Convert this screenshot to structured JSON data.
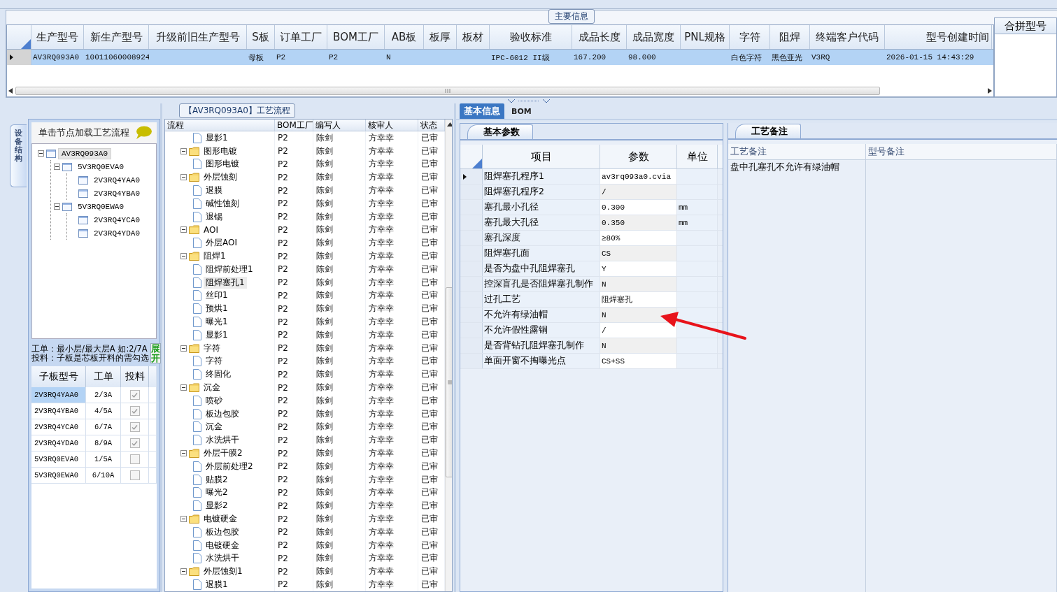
{
  "main_info": {
    "title": "主要信息",
    "columns": [
      "生产型号",
      "新生产型号",
      "升级前旧生产型号",
      "S板",
      "订单工厂",
      "BOM工厂",
      "AB板",
      "板厚",
      "板材",
      "验收标准",
      "成品长度",
      "成品宽度",
      "PNL规格",
      "字符",
      "阻焊",
      "终端客户代码",
      "型号创建时间"
    ],
    "rows": [
      {
        "selected": true,
        "cells": [
          "AV3RQ093A0",
          "10011060008924",
          "",
          "母板",
          "P2",
          "P2",
          "N",
          "",
          "",
          "IPC-6012 II级",
          "167.200",
          "98.000",
          "",
          "白色字符",
          "黑色亚光",
          "V3RQ",
          "2026-01-15 14:43:29"
        ]
      }
    ],
    "side_column": "合拼型号"
  },
  "equipment_panel": {
    "tab": "设备结构",
    "hint": "单击节点加载工艺流程",
    "tree": [
      {
        "label": "AV3RQ093A0",
        "selected": true,
        "expanded": true,
        "children": [
          {
            "label": "5V3RQ0EVA0",
            "selected": false,
            "expanded": true,
            "children": [
              {
                "label": "2V3RQ4YAA0",
                "selected": false
              },
              {
                "label": "2V3RQ4YBA0",
                "selected": false
              }
            ]
          },
          {
            "label": "5V3RQ0EWA0",
            "selected": false,
            "expanded": true,
            "children": [
              {
                "label": "2V3RQ4YCA0",
                "selected": false
              },
              {
                "label": "2V3RQ4YDA0",
                "selected": false
              }
            ]
          }
        ]
      }
    ],
    "note_lines": [
      "工单：最小层/最大层A 如:2/7A",
      "投料：子板是芯板开料的需勾选"
    ],
    "expand_button": "展开",
    "sub_boards": {
      "columns": [
        "子板型号",
        "工单",
        "投料"
      ],
      "rows": [
        {
          "model": "2V3RQ4YAA0",
          "order": "2/3A",
          "feed": true,
          "selected": true
        },
        {
          "model": "2V3RQ4YBA0",
          "order": "4/5A",
          "feed": true,
          "selected": false
        },
        {
          "model": "2V3RQ4YCA0",
          "order": "6/7A",
          "feed": true,
          "selected": false
        },
        {
          "model": "2V3RQ4YDA0",
          "order": "8/9A",
          "feed": true,
          "selected": false
        },
        {
          "model": "5V3RQ0EVA0",
          "order": "1/5A",
          "feed": false,
          "selected": false
        },
        {
          "model": "5V3RQ0EWA0",
          "order": "6/10A",
          "feed": false,
          "selected": false
        }
      ]
    }
  },
  "process_flow": {
    "title": "【AV3RQ093A0】工艺流程",
    "columns": [
      "流程",
      "BOM工厂",
      "编写人",
      "核审人",
      "状态"
    ],
    "rows": [
      {
        "kind": "step",
        "name": "显影1",
        "bom": "P2",
        "writer": "陈剑",
        "reviewer": "方幸幸",
        "status": "已审",
        "selected": false
      },
      {
        "kind": "group",
        "name": "图形电镀",
        "bom": "P2",
        "writer": "陈剑",
        "reviewer": "方幸幸",
        "status": "已审",
        "selected": false,
        "expanded": true,
        "children": [
          {
            "kind": "step",
            "name": "图形电镀",
            "bom": "P2",
            "writer": "陈剑",
            "reviewer": "方幸幸",
            "status": "已审",
            "selected": false
          }
        ]
      },
      {
        "kind": "group",
        "name": "外层蚀刻",
        "bom": "P2",
        "writer": "陈剑",
        "reviewer": "方幸幸",
        "status": "已审",
        "selected": false,
        "expanded": true,
        "children": [
          {
            "kind": "step",
            "name": "退膜",
            "bom": "P2",
            "writer": "陈剑",
            "reviewer": "方幸幸",
            "status": "已审",
            "selected": false
          },
          {
            "kind": "step",
            "name": "碱性蚀刻",
            "bom": "P2",
            "writer": "陈剑",
            "reviewer": "方幸幸",
            "status": "已审",
            "selected": false
          },
          {
            "kind": "step",
            "name": "退锡",
            "bom": "P2",
            "writer": "陈剑",
            "reviewer": "方幸幸",
            "status": "已审",
            "selected": false
          }
        ]
      },
      {
        "kind": "group",
        "name": "AOI",
        "bom": "P2",
        "writer": "陈剑",
        "reviewer": "方幸幸",
        "status": "已审",
        "selected": false,
        "expanded": true,
        "children": [
          {
            "kind": "step",
            "name": "外层AOI",
            "bom": "P2",
            "writer": "陈剑",
            "reviewer": "方幸幸",
            "status": "已审",
            "selected": false
          }
        ]
      },
      {
        "kind": "group",
        "name": "阻焊1",
        "bom": "P2",
        "writer": "陈剑",
        "reviewer": "方幸幸",
        "status": "已审",
        "selected": false,
        "expanded": true,
        "children": [
          {
            "kind": "step",
            "name": "阻焊前处理1",
            "bom": "P2",
            "writer": "陈剑",
            "reviewer": "方幸幸",
            "status": "已审",
            "selected": false
          },
          {
            "kind": "step",
            "name": "阻焊塞孔1",
            "bom": "P2",
            "writer": "陈剑",
            "reviewer": "方幸幸",
            "status": "已审",
            "selected": true
          },
          {
            "kind": "step",
            "name": "丝印1",
            "bom": "P2",
            "writer": "陈剑",
            "reviewer": "方幸幸",
            "status": "已审",
            "selected": false
          },
          {
            "kind": "step",
            "name": "预烘1",
            "bom": "P2",
            "writer": "陈剑",
            "reviewer": "方幸幸",
            "status": "已审",
            "selected": false
          },
          {
            "kind": "step",
            "name": "曝光1",
            "bom": "P2",
            "writer": "陈剑",
            "reviewer": "方幸幸",
            "status": "已审",
            "selected": false
          },
          {
            "kind": "step",
            "name": "显影1",
            "bom": "P2",
            "writer": "陈剑",
            "reviewer": "方幸幸",
            "status": "已审",
            "selected": false
          }
        ]
      },
      {
        "kind": "group",
        "name": "字符",
        "bom": "P2",
        "writer": "陈剑",
        "reviewer": "方幸幸",
        "status": "已审",
        "selected": false,
        "expanded": true,
        "children": [
          {
            "kind": "step",
            "name": "字符",
            "bom": "P2",
            "writer": "陈剑",
            "reviewer": "方幸幸",
            "status": "已审",
            "selected": false
          },
          {
            "kind": "step",
            "name": "终固化",
            "bom": "P2",
            "writer": "陈剑",
            "reviewer": "方幸幸",
            "status": "已审",
            "selected": false
          }
        ]
      },
      {
        "kind": "group",
        "name": "沉金",
        "bom": "P2",
        "writer": "陈剑",
        "reviewer": "方幸幸",
        "status": "已审",
        "selected": false,
        "expanded": true,
        "children": [
          {
            "kind": "step",
            "name": "喷砂",
            "bom": "P2",
            "writer": "陈剑",
            "reviewer": "方幸幸",
            "status": "已审",
            "selected": false
          },
          {
            "kind": "step",
            "name": "板边包胶",
            "bom": "P2",
            "writer": "陈剑",
            "reviewer": "方幸幸",
            "status": "已审",
            "selected": false
          },
          {
            "kind": "step",
            "name": "沉金",
            "bom": "P2",
            "writer": "陈剑",
            "reviewer": "方幸幸",
            "status": "已审",
            "selected": false
          },
          {
            "kind": "step",
            "name": "水洗烘干",
            "bom": "P2",
            "writer": "陈剑",
            "reviewer": "方幸幸",
            "status": "已审",
            "selected": false
          }
        ]
      },
      {
        "kind": "group",
        "name": "外层干膜2",
        "bom": "P2",
        "writer": "陈剑",
        "reviewer": "方幸幸",
        "status": "已审",
        "selected": false,
        "expanded": true,
        "children": [
          {
            "kind": "step",
            "name": "外层前处理2",
            "bom": "P2",
            "writer": "陈剑",
            "reviewer": "方幸幸",
            "status": "已审",
            "selected": false
          },
          {
            "kind": "step",
            "name": "贴膜2",
            "bom": "P2",
            "writer": "陈剑",
            "reviewer": "方幸幸",
            "status": "已审",
            "selected": false
          },
          {
            "kind": "step",
            "name": "曝光2",
            "bom": "P2",
            "writer": "陈剑",
            "reviewer": "方幸幸",
            "status": "已审",
            "selected": false
          },
          {
            "kind": "step",
            "name": "显影2",
            "bom": "P2",
            "writer": "陈剑",
            "reviewer": "方幸幸",
            "status": "已审",
            "selected": false
          }
        ]
      },
      {
        "kind": "group",
        "name": "电镀硬金",
        "bom": "P2",
        "writer": "陈剑",
        "reviewer": "方幸幸",
        "status": "已审",
        "selected": false,
        "expanded": true,
        "children": [
          {
            "kind": "step",
            "name": "板边包胶",
            "bom": "P2",
            "writer": "陈剑",
            "reviewer": "方幸幸",
            "status": "已审",
            "selected": false
          },
          {
            "kind": "step",
            "name": "电镀硬金",
            "bom": "P2",
            "writer": "陈剑",
            "reviewer": "方幸幸",
            "status": "已审",
            "selected": false
          },
          {
            "kind": "step",
            "name": "水洗烘干",
            "bom": "P2",
            "writer": "陈剑",
            "reviewer": "方幸幸",
            "status": "已审",
            "selected": false
          }
        ]
      },
      {
        "kind": "group",
        "name": "外层蚀刻1",
        "bom": "P2",
        "writer": "陈剑",
        "reviewer": "方幸幸",
        "status": "已审",
        "selected": false,
        "expanded": true,
        "children": [
          {
            "kind": "step",
            "name": "退膜1",
            "bom": "P2",
            "writer": "陈剑",
            "reviewer": "方幸幸",
            "status": "已审",
            "selected": false
          }
        ]
      }
    ]
  },
  "detail": {
    "tabs": [
      {
        "label": "基本信息",
        "selected": true
      },
      {
        "label": "BOM",
        "selected": false
      }
    ],
    "params": {
      "title": "基本参数",
      "columns": [
        "项目",
        "参数",
        "单位"
      ],
      "rows": [
        {
          "item": "阻焊塞孔程序1",
          "value": "av3rq093a0.cvia",
          "unit": "",
          "selected": true
        },
        {
          "item": "阻焊塞孔程序2",
          "value": "/",
          "unit": "",
          "selected": false
        },
        {
          "item": "塞孔最小孔径",
          "value": "0.300",
          "unit": "mm",
          "selected": false
        },
        {
          "item": "塞孔最大孔径",
          "value": "0.350",
          "unit": "mm",
          "selected": false
        },
        {
          "item": "塞孔深度",
          "value": "≥80%",
          "unit": "",
          "selected": false
        },
        {
          "item": "阻焊塞孔面",
          "value": "CS",
          "unit": "",
          "selected": false
        },
        {
          "item": "是否为盘中孔阻焊塞孔",
          "value": "Y",
          "unit": "",
          "selected": false
        },
        {
          "item": "控深盲孔是否阻焊塞孔制作",
          "value": "N",
          "unit": "",
          "selected": false
        },
        {
          "item": "过孔工艺",
          "value": "阻焊塞孔",
          "unit": "",
          "selected": false
        },
        {
          "item": "不允许有绿油帽",
          "value": "N",
          "unit": "",
          "selected": false
        },
        {
          "item": "不允许假性露铜",
          "value": "/",
          "unit": "",
          "selected": false
        },
        {
          "item": "是否背钻孔阻焊塞孔制作",
          "value": "N",
          "unit": "",
          "selected": false
        },
        {
          "item": "单面开窗不掏曝光点",
          "value": "CS+SS",
          "unit": "",
          "selected": false
        }
      ]
    },
    "remarks": {
      "title": "工艺备注",
      "columns": [
        "工艺备注",
        "型号备注"
      ],
      "rows": [
        {
          "process_note": "盘中孔塞孔不允许有绿油帽"
        }
      ]
    }
  }
}
